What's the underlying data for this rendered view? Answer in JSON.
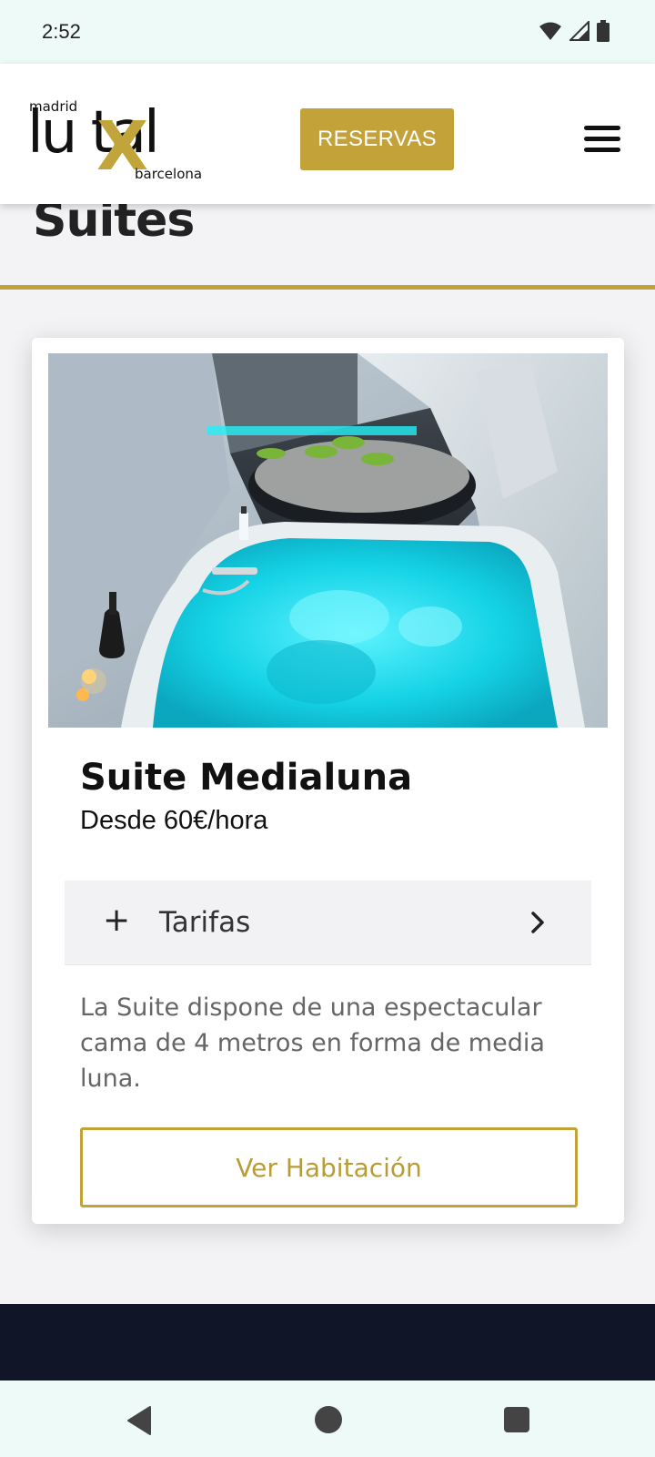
{
  "status_bar": {
    "time": "2:52",
    "icons": [
      "wifi-icon",
      "signal-icon",
      "battery-icon"
    ]
  },
  "header": {
    "logo": {
      "top_text": "madrid",
      "main_text": "lu tal",
      "x_text": "X",
      "bottom_text": "barcelona"
    },
    "reserve_label": "RESERVAS",
    "menu_icon": "hamburger-menu-icon"
  },
  "page": {
    "title": "Suites"
  },
  "card": {
    "name": "Suite Medialuna",
    "price": "Desde 60€/hora",
    "accordion": {
      "label": "Tarifas",
      "expand_icon": "plus-icon",
      "chevron_icon": "chevron-right-icon"
    },
    "description": "La Suite dispone de una espectacular cama de 4 metros en forma de media luna.",
    "button_label": "Ver Habitación"
  },
  "colors": {
    "accent_gold": "#c3a23a",
    "footer_navy": "#101528",
    "system_bar": "#eefaf8",
    "jacuzzi_cyan": "#1fe3f0"
  },
  "nav_bar": {
    "icons": [
      "back-icon",
      "home-icon",
      "recents-icon"
    ]
  }
}
